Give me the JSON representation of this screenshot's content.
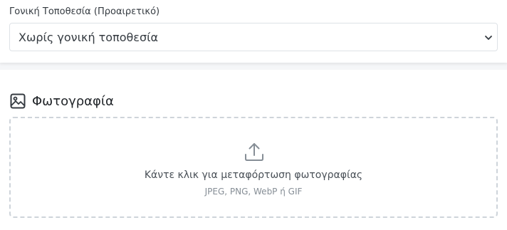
{
  "parent_location": {
    "label": "Γονική Τοποθεσία (Προαιρετικό)",
    "selected_value": "Χωρίς γονική τοποθεσία"
  },
  "photo_section": {
    "title": "Φωτογραφία",
    "icon": "image-icon",
    "dropzone": {
      "icon": "upload-icon",
      "main_text": "Κάντε κλικ για μεταφόρτωση φωτογραφίας",
      "sub_text": "JPEG, PNG, WebP ή GIF"
    }
  }
}
